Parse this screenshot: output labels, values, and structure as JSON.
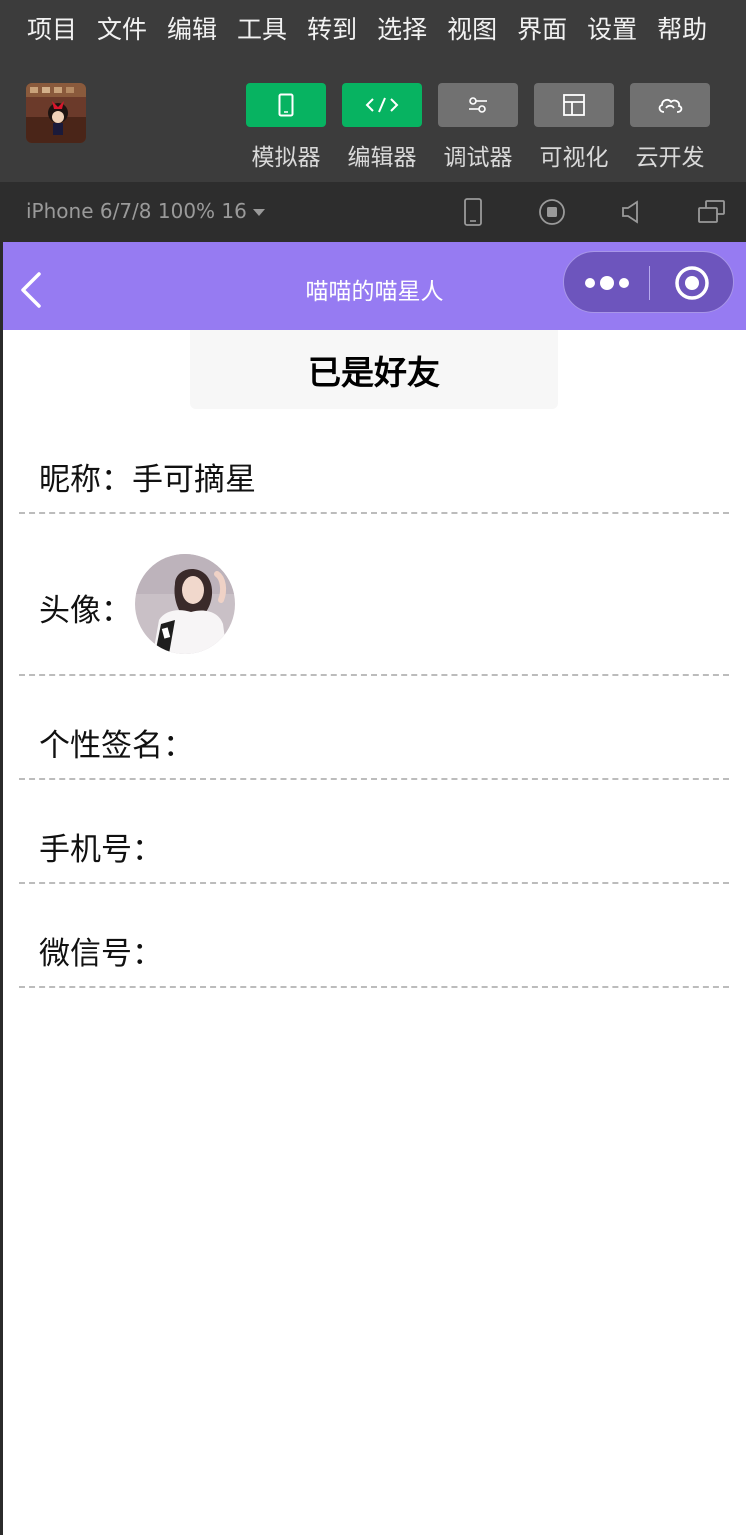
{
  "menu": [
    "项目",
    "文件",
    "编辑",
    "工具",
    "转到",
    "选择",
    "视图",
    "界面",
    "设置",
    "帮助"
  ],
  "toolbar": {
    "simulator_label": "模拟器",
    "editor_label": "编辑器",
    "debugger_label": "调试器",
    "visual_label": "可视化",
    "cloud_label": "云开发"
  },
  "device": {
    "selector_text": "iPhone 6/7/8 100% 16"
  },
  "navbar": {
    "title": "喵喵的喵星人"
  },
  "page": {
    "status": "已是好友",
    "nickname_label": "昵称：",
    "nickname_value": "手可摘星",
    "avatar_label": "头像：",
    "signature_label": "个性签名：",
    "phone_label": "手机号：",
    "wechat_label": "微信号："
  },
  "colors": {
    "navbar": "#967bf2",
    "primary_green": "#07b361",
    "menu_bg": "#3c3c3c",
    "capsule": "#6d55bd"
  },
  "icons": {
    "simulator": "phone-outline-icon",
    "editor": "code-brackets-icon",
    "debugger": "sliders-icon",
    "visual": "layout-icon",
    "cloud": "cloud-icon",
    "back": "chevron-left-icon",
    "more": "more-dots-icon",
    "close": "target-circle-icon"
  }
}
